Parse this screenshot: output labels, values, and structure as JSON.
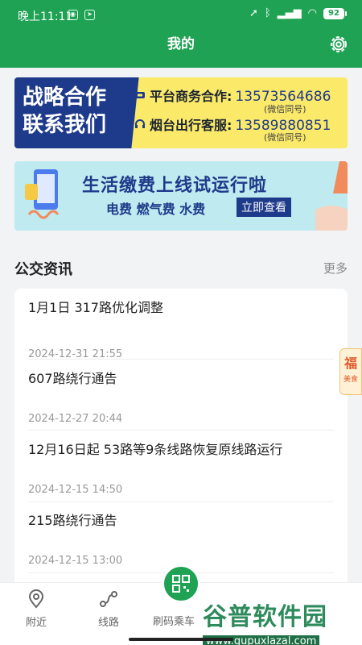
{
  "status_bar": {
    "time": "晚上11:11",
    "battery": "92"
  },
  "header": {
    "title": "我的"
  },
  "coop_banner": {
    "left_line1": "战略合作",
    "left_line2": "联系我们",
    "business_label": "平台商务合作:",
    "business_phone": "13573564686",
    "business_note": "(微信同号)",
    "service_label": "烟台出行客服:",
    "service_phone": "13589880851",
    "service_note": "(微信同号)"
  },
  "pay_banner": {
    "title": "生活缴费上线试运行啦",
    "items": "电费 燃气费 水费",
    "button": "立即查看"
  },
  "news": {
    "title": "公交资讯",
    "more": "更多",
    "items": [
      {
        "headline": "1月1日 317路优化调整",
        "date": "2024-12-31 21:55"
      },
      {
        "headline": "607路绕行通告",
        "date": "2024-12-27 20:44"
      },
      {
        "headline": "12月16日起 53路等9条线路恢复原线路运行",
        "date": "2024-12-15 14:50"
      },
      {
        "headline": "215路绕行通告",
        "date": "2024-12-15 13:00"
      }
    ]
  },
  "floating": {
    "char": "福",
    "sub": "美食"
  },
  "tabbar": {
    "nearby": "附近",
    "routes": "线路",
    "scan": "刷码乘车"
  },
  "watermark": {
    "brand": "谷普软件园",
    "url": "www.gupuxlazal.com"
  }
}
